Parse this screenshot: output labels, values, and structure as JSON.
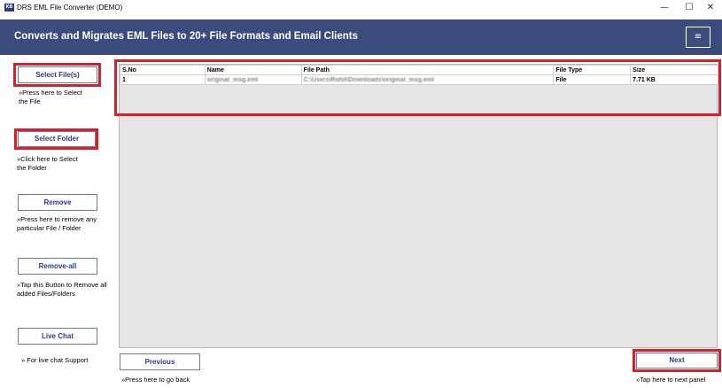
{
  "window": {
    "icon_text": "KB",
    "title": "DRS EML File Converter (DEMO)",
    "minimize": "—",
    "maximize": "☐",
    "close": "✕"
  },
  "header": {
    "title": "Converts and Migrates EML Files to 20+ File Formats and Email Clients",
    "menu_icon": "≡"
  },
  "sidebar": {
    "select_files_label": "Select File(s)",
    "select_files_hint_1": "»Press here to Select",
    "select_files_hint_2": "the File",
    "select_folder_label": "Select Folder",
    "select_folder_hint_1": "»Click here to Select",
    "select_folder_hint_2": "the Folder",
    "remove_label": "Remove",
    "remove_hint_1": "»Press here to remove any",
    "remove_hint_2": "particular File / Folder",
    "remove_all_label": "Remove-all",
    "remove_all_hint_1": "»Tap this Button to Remove all",
    "remove_all_hint_2": "added Files/Folders",
    "live_chat_label": "Live Chat",
    "live_chat_hint": "» For live chat Support"
  },
  "table": {
    "columns": [
      "S.No",
      "Name",
      "File Path",
      "File Type",
      "Size"
    ],
    "rows": [
      [
        "1",
        "original_msg.eml",
        "C:\\Users\\Rohit\\Downloads\\original_msg.eml",
        "File",
        "7.71 KB"
      ]
    ]
  },
  "footer": {
    "previous_label": "Previous",
    "previous_hint": "»Press here to go back",
    "next_label": "Next",
    "next_hint": "»Tap here to next panel"
  },
  "colors": {
    "header_bg": "#3b4b7c",
    "highlight": "#d81f2a",
    "button_text": "#2c3e78"
  }
}
